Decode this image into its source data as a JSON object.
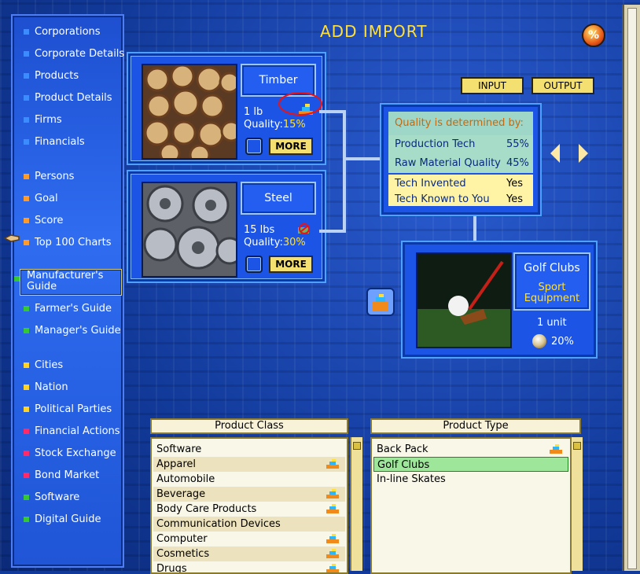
{
  "page": {
    "title": "ADD IMPORT",
    "percent_icon": "%"
  },
  "sidebar": {
    "items": [
      {
        "label": "Corporations",
        "color": "#3a8cff"
      },
      {
        "label": "Corporate Details",
        "color": "#3a8cff"
      },
      {
        "label": "Products",
        "color": "#3a8cff"
      },
      {
        "label": "Product Details",
        "color": "#3a8cff"
      },
      {
        "label": "Firms",
        "color": "#3a8cff"
      },
      {
        "label": "Financials",
        "color": "#3a8cff"
      },
      {
        "label": "Persons",
        "color": "#ff9b2a"
      },
      {
        "label": "Goal",
        "color": "#ff9b2a"
      },
      {
        "label": "Score",
        "color": "#ff9b2a"
      },
      {
        "label": "Top 100 Charts",
        "color": "#ff9b2a"
      },
      {
        "label": "Manufacturer's Guide",
        "color": "#35c735"
      },
      {
        "label": "Farmer's Guide",
        "color": "#35c735"
      },
      {
        "label": "Manager's Guide",
        "color": "#35c735"
      },
      {
        "label": "Cities",
        "color": "#ffd42a"
      },
      {
        "label": "Nation",
        "color": "#ffd42a"
      },
      {
        "label": "Political Parties",
        "color": "#ffd42a"
      },
      {
        "label": "Financial Actions",
        "color": "#ff2a6a"
      },
      {
        "label": "Stock Exchange",
        "color": "#ff2a6a"
      },
      {
        "label": "Bond Market",
        "color": "#ff2a6a"
      },
      {
        "label": "Software",
        "color": "#35c735"
      },
      {
        "label": "Digital Guide",
        "color": "#35c735"
      }
    ]
  },
  "inputs": [
    {
      "name": "Timber",
      "qty": "1 lb",
      "quality_label": "Quality:",
      "quality_value": "15%",
      "more": "MORE"
    },
    {
      "name": "Steel",
      "qty": "15 lbs",
      "quality_label": "Quality:",
      "quality_value": "30%",
      "more": "MORE"
    }
  ],
  "io_buttons": {
    "input": "INPUT",
    "output": "OUTPUT"
  },
  "quality_panel": {
    "header": "Quality is determined by:",
    "rows": [
      {
        "k": "Production Tech",
        "v": "55%"
      },
      {
        "k": "Raw Material Quality",
        "v": "45%"
      },
      {
        "k": "Tech Invented",
        "v": "Yes"
      },
      {
        "k": "Tech Known to You",
        "v": "Yes"
      }
    ]
  },
  "output": {
    "name": "Golf Clubs",
    "category": "Sport Equipment",
    "unit": "1 unit",
    "pct": "20%"
  },
  "product_class": {
    "header": "Product Class",
    "items": [
      {
        "label": "Software",
        "icon": false
      },
      {
        "label": "Apparel",
        "icon": true
      },
      {
        "label": "Automobile",
        "icon": false
      },
      {
        "label": "Beverage",
        "icon": true
      },
      {
        "label": "Body Care Products",
        "icon": true
      },
      {
        "label": "Communication Devices",
        "icon": false
      },
      {
        "label": "Computer",
        "icon": true
      },
      {
        "label": "Cosmetics",
        "icon": true
      },
      {
        "label": "Drugs",
        "icon": true
      }
    ]
  },
  "product_type": {
    "header": "Product Type",
    "items": [
      {
        "label": "Back Pack",
        "icon": true
      },
      {
        "label": "Golf Clubs",
        "icon": false,
        "selected": true
      },
      {
        "label": "In-line Skates",
        "icon": false
      }
    ]
  }
}
